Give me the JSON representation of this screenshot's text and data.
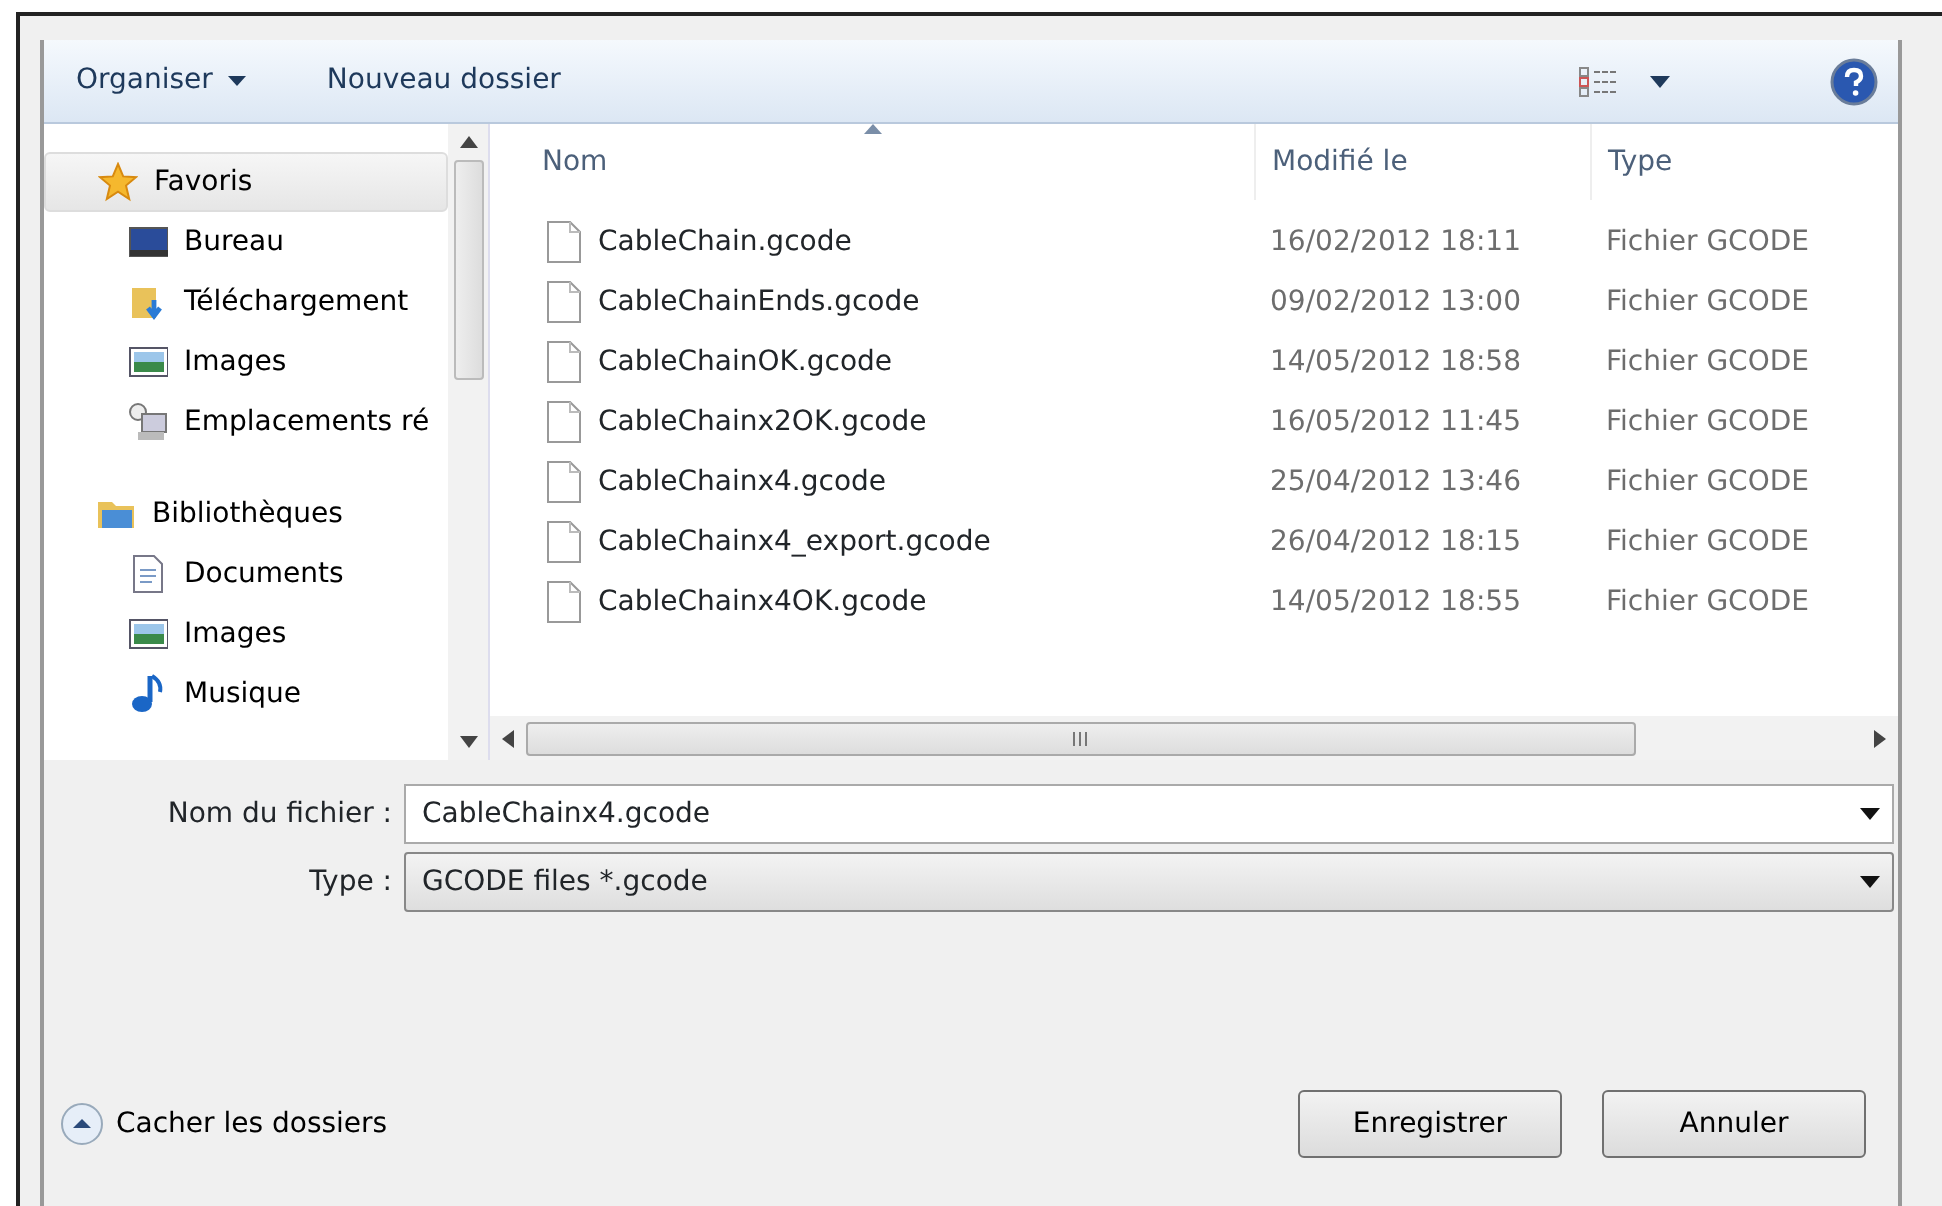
{
  "toolbar": {
    "organize": "Organiser",
    "new_folder": "Nouveau dossier"
  },
  "sidebar": {
    "items": [
      {
        "kind": "group",
        "label": "Favoris",
        "selected": true
      },
      {
        "kind": "item",
        "label": "Bureau",
        "selected": false
      },
      {
        "kind": "item",
        "label": "Téléchargement",
        "selected": false
      },
      {
        "kind": "item",
        "label": "Images",
        "selected": false
      },
      {
        "kind": "item",
        "label": "Emplacements ré",
        "selected": false
      },
      {
        "kind": "group",
        "label": "Bibliothèques",
        "selected": false
      },
      {
        "kind": "item",
        "label": "Documents",
        "selected": false
      },
      {
        "kind": "item",
        "label": "Images",
        "selected": false
      },
      {
        "kind": "item",
        "label": "Musique",
        "selected": false
      }
    ]
  },
  "table": {
    "columns": [
      {
        "label": "Nom",
        "sorted": true
      },
      {
        "label": "Modifié le",
        "sorted": false
      },
      {
        "label": "Type",
        "sorted": false
      }
    ],
    "rows": [
      [
        "CableChain.gcode",
        "16/02/2012 18:11",
        "Fichier GCODE"
      ],
      [
        "CableChainEnds.gcode",
        "09/02/2012 13:00",
        "Fichier GCODE"
      ],
      [
        "CableChainOK.gcode",
        "14/05/2012 18:58",
        "Fichier GCODE"
      ],
      [
        "CableChainx2OK.gcode",
        "16/05/2012 11:45",
        "Fichier GCODE"
      ],
      [
        "CableChainx4.gcode",
        "25/04/2012 13:46",
        "Fichier GCODE"
      ],
      [
        "CableChainx4_export.gcode",
        "26/04/2012 18:15",
        "Fichier GCODE"
      ],
      [
        "CableChainx4OK.gcode",
        "14/05/2012 18:55",
        "Fichier GCODE"
      ]
    ]
  },
  "filename": {
    "label": "Nom du fichier :",
    "value": "CableChainx4.gcode"
  },
  "filetype": {
    "label": "Type :",
    "value": "GCODE files *.gcode"
  },
  "hide_folders": "Cacher les dossiers",
  "buttons": [
    "Enregistrer",
    "Annuler"
  ]
}
